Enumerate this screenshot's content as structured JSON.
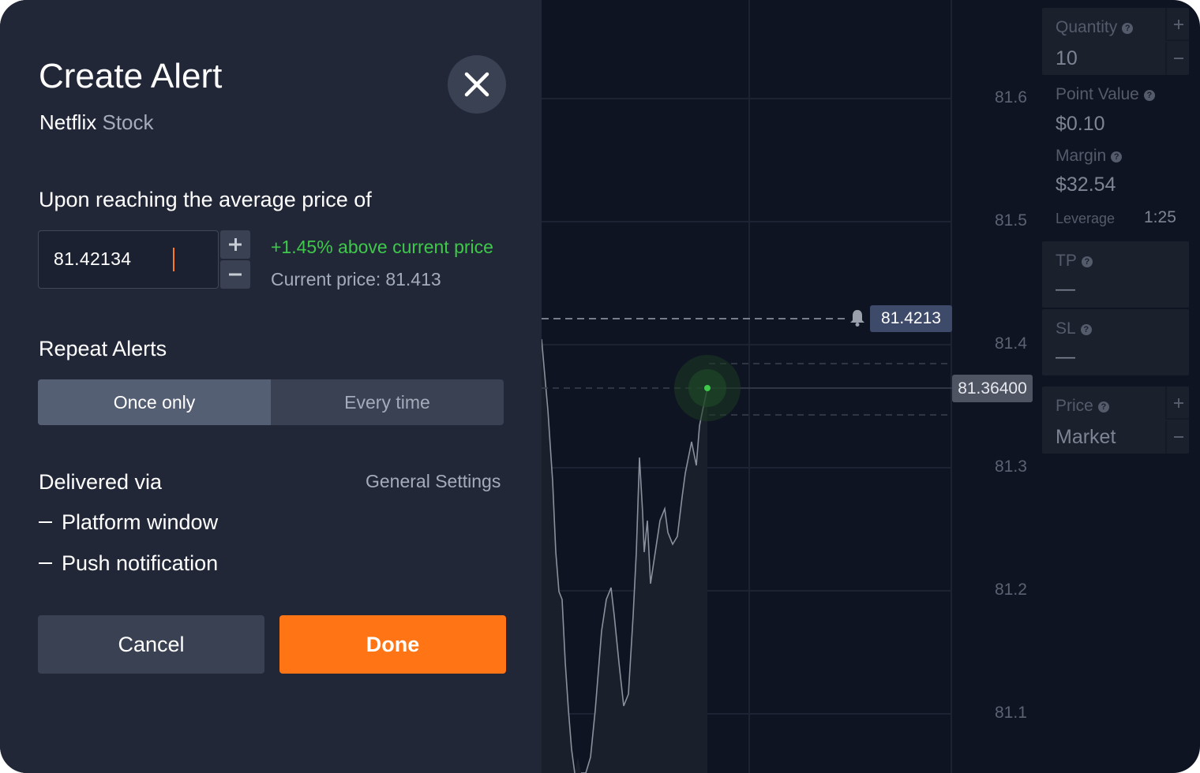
{
  "modal": {
    "title": "Create Alert",
    "subtitle_name": "Netflix",
    "subtitle_type": "Stock",
    "price_label": "Upon reaching the average price of",
    "price_value": "81.42134",
    "above_text": "+1.45% above current price",
    "current_label": "Current price:",
    "current_value": "81.413",
    "repeat_label": "Repeat Alerts",
    "repeat_options": [
      "Once only",
      "Every time"
    ],
    "delivered_label": "Delivered via",
    "general_settings": "General Settings",
    "delivery_options": [
      "Platform window",
      "Push notification"
    ],
    "cancel_label": "Cancel",
    "done_label": "Done",
    "icons": {
      "close": "close-icon",
      "plus": "plus-icon",
      "minus": "minus-icon"
    }
  },
  "chart": {
    "y_ticks": [
      "81.6",
      "81.5",
      "81.4",
      "81.3",
      "81.2",
      "81.1"
    ],
    "alert_price": "81.4213",
    "current_price": "81.36400",
    "colors": {
      "accent": "#ff7515",
      "positive": "#3ec94a",
      "alert_tag": "#3d4a6a"
    }
  },
  "panel": {
    "quantity_label": "Quantity",
    "quantity_value": "10",
    "point_value_label": "Point Value",
    "point_value": "$0.10",
    "margin_label": "Margin",
    "margin_value": "$32.54",
    "leverage_label": "Leverage",
    "leverage_value": "1:25",
    "tp_label": "TP",
    "tp_value": "—",
    "sl_label": "SL",
    "sl_value": "—",
    "price_label": "Price",
    "price_value": "Market"
  }
}
